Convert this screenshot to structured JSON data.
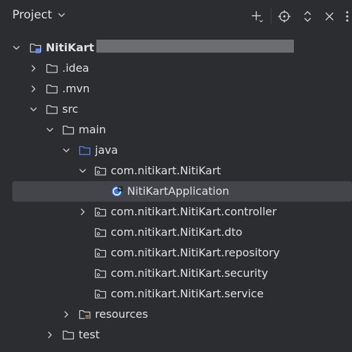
{
  "header": {
    "title": "Project",
    "icons": [
      "chevron-down-icon",
      "add-icon",
      "locate-icon",
      "expand-collapse-icon",
      "close-icon",
      "more-icon"
    ]
  },
  "tree": {
    "root": {
      "label": "NitiKart",
      "icon": "module-icon",
      "expanded": true
    },
    "idea": {
      "label": ".idea",
      "icon": "folder-icon",
      "expanded": false
    },
    "mvn": {
      "label": ".mvn",
      "icon": "folder-icon",
      "expanded": false
    },
    "src": {
      "label": "src",
      "icon": "folder-icon",
      "expanded": true
    },
    "main": {
      "label": "main",
      "icon": "folder-icon",
      "expanded": true
    },
    "java": {
      "label": "java",
      "icon": "source-folder-icon",
      "expanded": true
    },
    "pkg_root": {
      "label": "com.nitikart.NitiKart",
      "icon": "package-icon",
      "expanded": true
    },
    "app_class": {
      "label": "NitiKartApplication",
      "icon": "spring-class-icon",
      "selected": true
    },
    "pkg_controller": {
      "label": "com.nitikart.NitiKart.controller",
      "icon": "package-icon",
      "expanded": false
    },
    "pkg_dto": {
      "label": "com.nitikart.NitiKart.dto",
      "icon": "package-icon"
    },
    "pkg_repository": {
      "label": "com.nitikart.NitiKart.repository",
      "icon": "package-icon"
    },
    "pkg_security": {
      "label": "com.nitikart.NitiKart.security",
      "icon": "package-icon"
    },
    "pkg_service": {
      "label": "com.nitikart.NitiKart.service",
      "icon": "package-icon"
    },
    "resources": {
      "label": "resources",
      "icon": "resources-folder-icon",
      "expanded": false
    },
    "test": {
      "label": "test",
      "icon": "folder-icon",
      "expanded": false
    }
  },
  "colors": {
    "background": "#2b2d30",
    "selection": "#43454a",
    "text": "#dfe1e5",
    "icon": "#ced0d6",
    "source_folder": "#548af7",
    "spring": "#5fb865"
  }
}
